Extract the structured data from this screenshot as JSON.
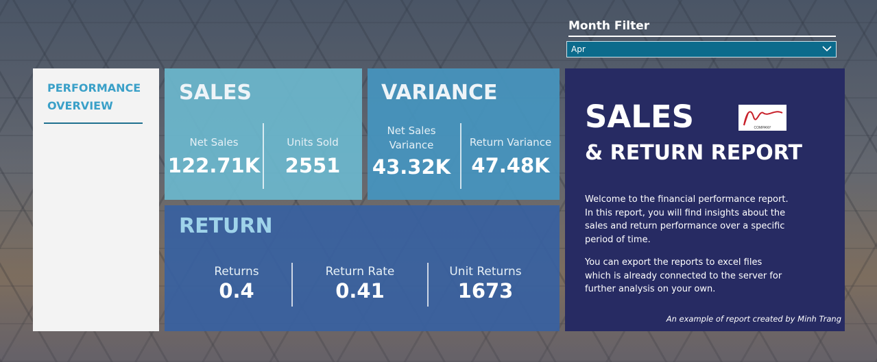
{
  "filter": {
    "title": "Month Filter",
    "selected": "Apr"
  },
  "nav": {
    "title": "PERFORMANCE OVERVIEW"
  },
  "sales": {
    "title": "SALES",
    "net_sales_label": "Net Sales",
    "net_sales_value": "122.71K",
    "units_sold_label": "Units Sold",
    "units_sold_value": "2551"
  },
  "variance": {
    "title": "VARIANCE",
    "net_sales_variance_label": "Net Sales Variance",
    "net_sales_variance_value": "43.32K",
    "return_variance_label": "Return Variance",
    "return_variance_value": "47.48K"
  },
  "return": {
    "title": "RETURN",
    "returns_label": "Returns",
    "returns_value": "0.4",
    "return_rate_label": "Return Rate",
    "return_rate_value": "0.41",
    "unit_returns_label": "Unit Returns",
    "unit_returns_value": "1673"
  },
  "info": {
    "heading": "SALES",
    "subheading": "& RETURN REPORT",
    "logo_text": "COMPANY",
    "paragraph1": "Welcome to the financial performance report. In this report, you will find insights about the sales and return performance over a specific period of time.",
    "paragraph2": "You can export the reports to excel files which is already connected to the server for further analysis on your own.",
    "credit": "An example of report created by Minh Trang"
  },
  "colors": {
    "sales_card": "#6bb7cd",
    "variance_card": "#4694be",
    "return_card": "#3861a0",
    "info_panel": "#272b63",
    "filter_bg": "#0c6b8c",
    "nav_accent": "#3aa0c8"
  },
  "icons": {
    "dropdown": "chevron-down-icon",
    "logo": "company-logo"
  }
}
